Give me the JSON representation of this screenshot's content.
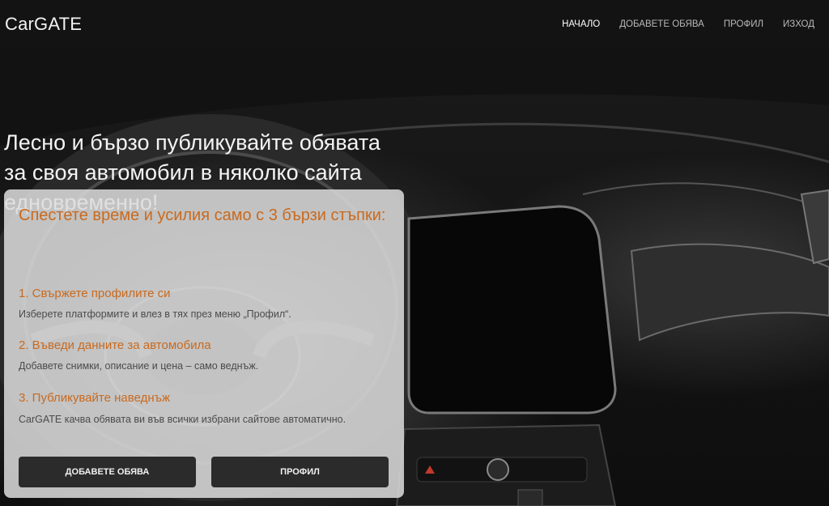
{
  "navbar": {
    "brand": "CarGATE",
    "links": [
      {
        "label": "НАЧАЛО",
        "active": true
      },
      {
        "label": "ДОБАВЕТЕ ОБЯВА",
        "active": false
      },
      {
        "label": "ПРОФИЛ",
        "active": false
      },
      {
        "label": "ИЗХОД",
        "active": false
      }
    ]
  },
  "hero": {
    "headline": "Лесно и бързо публикувайте обявата за своя автомобил в няколко сайта едновременно!"
  },
  "card": {
    "title": "Спестете време и усилия само с 3 бързи стъпки:",
    "steps": [
      {
        "title": "1. Свържете профилите си",
        "text": "Изберете платформите и влез в тях през меню „Профил“."
      },
      {
        "title": "2. Въведи данните за автомобила",
        "text": "Добавете снимки, описание и цена – само веднъж."
      },
      {
        "title": "3. Публикувайте наведнъж",
        "text": "CarGATE качва обявата ви във всички избрани сайтове автоматично."
      }
    ],
    "buttons": {
      "add_listing": "ДОБАВЕТЕ ОБЯВА",
      "profile": "ПРОФИЛ"
    }
  },
  "colors": {
    "accent": "#c96a1e",
    "navbar_bg": "#131313",
    "button_bg": "#2b2b2b"
  }
}
